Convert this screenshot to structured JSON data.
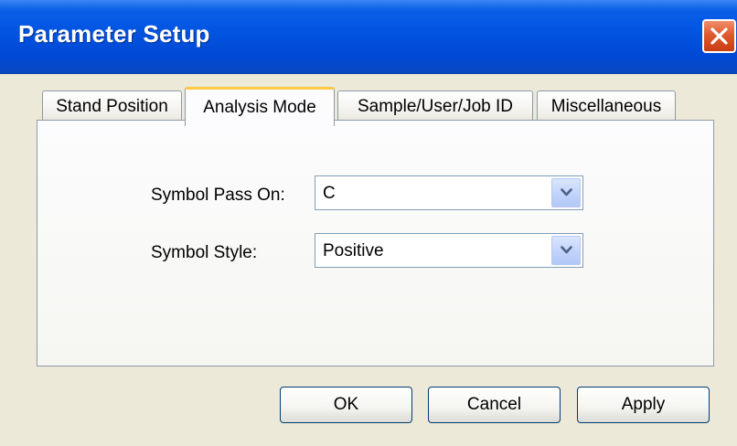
{
  "window": {
    "title": "Parameter Setup"
  },
  "tabs": [
    {
      "label": "Stand Position",
      "active": false
    },
    {
      "label": "Analysis Mode",
      "active": true
    },
    {
      "label": "Sample/User/Job ID",
      "active": false
    },
    {
      "label": "Miscellaneous",
      "active": false
    }
  ],
  "form": {
    "symbol_pass_on": {
      "label": "Symbol Pass On:",
      "value": "C"
    },
    "symbol_style": {
      "label": "Symbol Style:",
      "value": "Positive"
    }
  },
  "buttons": {
    "ok": "OK",
    "cancel": "Cancel",
    "apply": "Apply"
  },
  "colors": {
    "titlebar": "#0255e2",
    "close_button": "#de5a2e",
    "active_tab_accent": "#ffc845",
    "window_face": "#ece9d8",
    "combo_border": "#7f9db9"
  },
  "icons": {
    "close": "close-icon",
    "dropdown": "chevron-down-icon"
  }
}
